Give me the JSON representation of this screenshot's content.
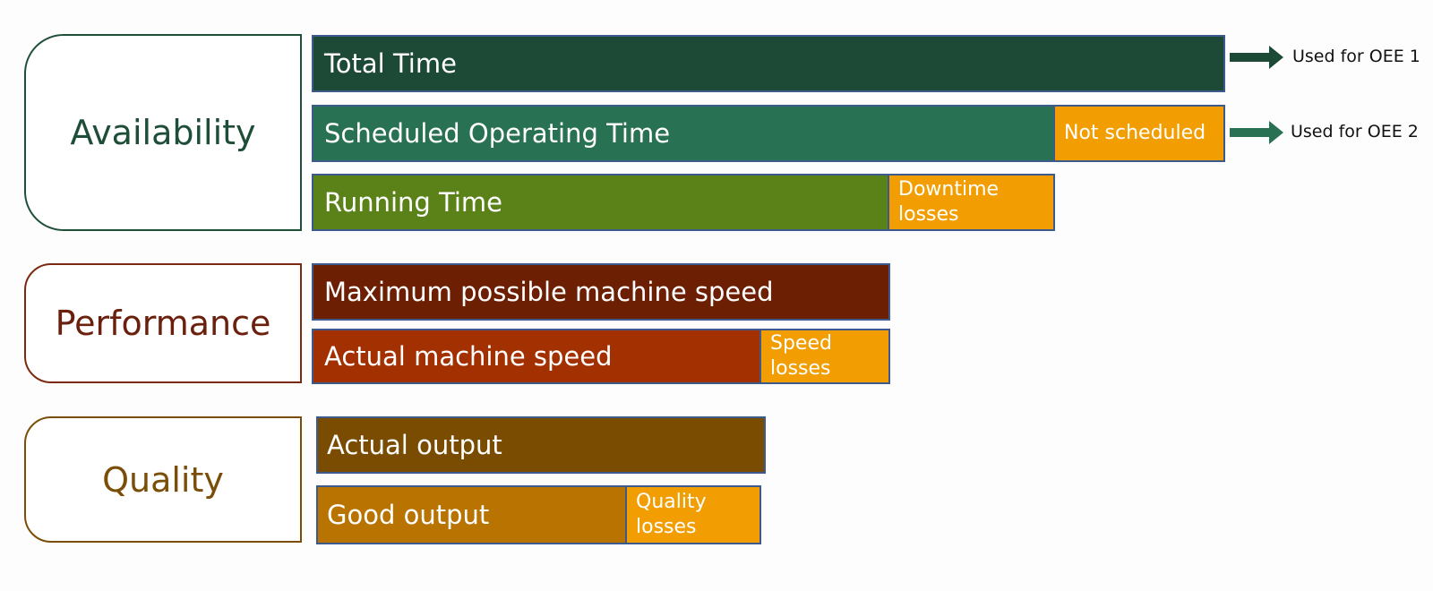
{
  "categories": {
    "availability": "Availability",
    "performance": "Performance",
    "quality": "Quality"
  },
  "bars": {
    "total_time": {
      "label": "Total Time"
    },
    "scheduled_operating_time": {
      "label": "Scheduled Operating Time",
      "loss": "Not scheduled"
    },
    "running_time": {
      "label": "Running Time",
      "loss": "Downtime losses"
    },
    "max_machine_speed": {
      "label": "Maximum possible machine speed"
    },
    "actual_machine_speed": {
      "label": "Actual machine speed",
      "loss": "Speed losses"
    },
    "actual_output": {
      "label": "Actual output"
    },
    "good_output": {
      "label": "Good output",
      "loss": "Quality losses"
    }
  },
  "annotations": {
    "oee1": "Used for OEE 1",
    "oee2": "Used for OEE 2"
  },
  "colors": {
    "availability": "#1e4d38",
    "performance": "#6a200c",
    "quality": "#7a4e08",
    "loss": "#f29e02",
    "total_time": "#1c4a36",
    "scheduled_operating_time": "#287253",
    "running_time": "#5a8219",
    "max_machine_speed": "#6c1f02",
    "actual_machine_speed": "#a33000",
    "actual_output": "#794c02",
    "good_output": "#b87300"
  }
}
